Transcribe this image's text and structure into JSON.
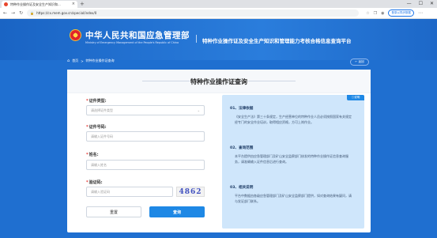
{
  "browser": {
    "tab_title": "特种作业操作证及安全生产知识和...",
    "tab_close": "×",
    "new_tab": "+",
    "url": "https://cx.mem.gov.cn/special/index/0",
    "login_label": "登录以同步数据",
    "nav": {
      "back": "←",
      "forward": "→",
      "reload": "↻",
      "lock": "🔒"
    },
    "window_controls": {
      "minimize": "—",
      "maximize": "☐",
      "close": "✕"
    },
    "icons": [
      "star-icon",
      "collections-icon",
      "profile-icon",
      "menu-icon"
    ]
  },
  "header": {
    "cn_title": "中华人民共和国应急管理部",
    "en_title": "Ministry of Emergency Management of the People's Republic of China",
    "platform_title": "特种作业操作证及安全生产知识和管理能力考核合格信息查询平台"
  },
  "breadcrumb": {
    "home": "首页",
    "sep": ">",
    "current": "特种作业操作证查询",
    "back_label": "← 返回"
  },
  "form": {
    "title": "特种作业操作证查询",
    "required_mark": "*",
    "cert_type": {
      "label": "证件类型:",
      "placeholder": "请选择证件类型",
      "chevron": "⌄"
    },
    "cert_no": {
      "label": "证件号码:",
      "placeholder": "请输入证件号码"
    },
    "name": {
      "label": "姓名:",
      "placeholder": "请输入姓名"
    },
    "captcha": {
      "label": "验证码:",
      "placeholder": "请输入验证码",
      "image_text": "4862"
    },
    "reset_label": "重置",
    "query_label": "查询"
  },
  "notice": {
    "tag": "说明",
    "sections": [
      {
        "title": "01、法律依据",
        "body": "《安全生产法》第三十条规定，生产经营单位的特种作业人员必须按照国家有关规定经专门的安全作业培训，取得相应资格，方可上岗作业。"
      },
      {
        "title": "02、查询范围",
        "body": "本平台提供由应急管理部门及矿山安全监察部门核发的特种作业操作证信息查询服务，请准确输入证件信息后进行查询。"
      },
      {
        "title": "03、相关说明",
        "body": "平台中数据由各级应急管理部门及矿山安全监察部门提供，如对查询结果有疑问，请与发证部门联系。"
      }
    ]
  },
  "colors": {
    "brand_blue": "#1e88e5",
    "header_blue": "#1f6fd0",
    "notice_bg": "#cfe6fb",
    "required": "#e53935"
  }
}
